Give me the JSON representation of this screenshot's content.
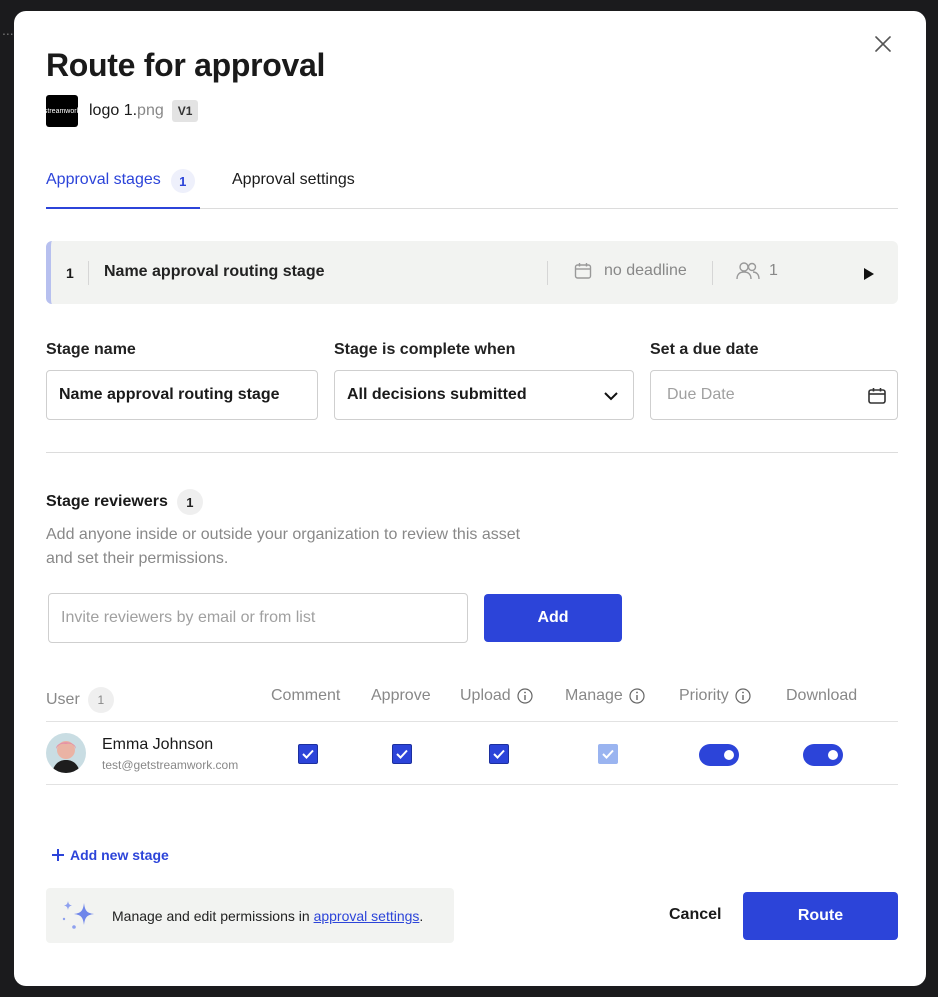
{
  "background": {
    "frag_dots": "..."
  },
  "modal": {
    "title": "Route for approval",
    "file": {
      "thumb_text": "streamwork",
      "name": "logo 1.",
      "ext": "png",
      "version": "V1"
    },
    "tabs": [
      {
        "label": "Approval stages",
        "count": "1",
        "active": true
      },
      {
        "label": "Approval settings",
        "active": false
      }
    ],
    "stage": {
      "number": "1",
      "name": "Name approval routing stage",
      "deadline": "no deadline",
      "people": "1"
    },
    "form": {
      "stage_name_label": "Stage name",
      "stage_name_value": "Name approval routing stage",
      "complete_label": "Stage is complete when",
      "complete_value": "All decisions submitted",
      "due_label": "Set a due date",
      "due_placeholder": "Due Date"
    },
    "reviewers": {
      "title": "Stage reviewers",
      "count": "1",
      "description": "Add anyone inside or outside your organization to review this asset and set their permissions.",
      "invite_placeholder": "Invite reviewers by email or from list",
      "add_label": "Add"
    },
    "table": {
      "headers": {
        "user": "User",
        "user_count": "1",
        "comment": "Comment",
        "approve": "Approve",
        "upload": "Upload",
        "manage": "Manage",
        "priority": "Priority",
        "download": "Download"
      },
      "rows": [
        {
          "name": "Emma Johnson",
          "email": "test@getstreamwork.com",
          "comment": true,
          "approve": true,
          "upload": true,
          "manage": true,
          "priority": true,
          "download": true
        }
      ]
    },
    "add_stage_label": "Add new stage",
    "tip": {
      "prefix": "Manage and edit permissions in ",
      "link": "approval settings",
      "suffix": "."
    },
    "footer": {
      "cancel_label": "Cancel",
      "route_label": "Route"
    },
    "colors": {
      "accent": "#2c44d9",
      "stage_border": "#b7c0ef",
      "panel_bg": "#f2f3f1"
    }
  }
}
